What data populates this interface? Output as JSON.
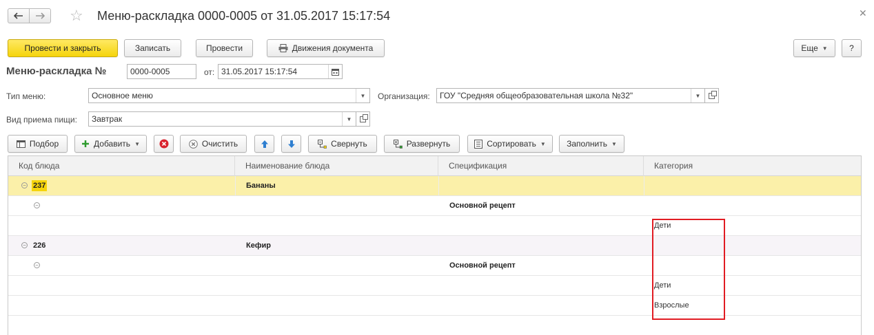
{
  "window": {
    "title": "Меню-раскладка 0000-0005 от 31.05.2017 15:17:54"
  },
  "toolbar": {
    "post_close": "Провести и закрыть",
    "save": "Записать",
    "post": "Провести",
    "movements": "Движения документа",
    "more": "Еще",
    "help": "?"
  },
  "header": {
    "doc_label": "Меню-раскладка №",
    "number": "0000-0005",
    "from_label": "от:",
    "date": "31.05.2017 15:17:54",
    "menu_type_label": "Тип меню:",
    "menu_type": "Основное меню",
    "org_label": "Организация:",
    "org": "ГОУ \"Средняя общеобразовательная школа №32\"",
    "meal_label": "Вид приема пищи:",
    "meal": "Завтрак"
  },
  "table_toolbar": {
    "pick": "Подбор",
    "add": "Добавить",
    "clear": "Очистить",
    "collapse": "Свернуть",
    "expand": "Развернуть",
    "sort": "Сортировать",
    "fill": "Заполнить"
  },
  "table": {
    "columns": [
      "Код блюда",
      "Наименование блюда",
      "Спецификация",
      "Категория"
    ],
    "rows": [
      {
        "code": "237",
        "name": "Бананы",
        "spec": "",
        "category": ""
      },
      {
        "code": "",
        "name": "",
        "spec": "Основной рецепт",
        "category": ""
      },
      {
        "code": "",
        "name": "",
        "spec": "",
        "category": "Дети"
      },
      {
        "code": "226",
        "name": "Кефир",
        "spec": "",
        "category": ""
      },
      {
        "code": "",
        "name": "",
        "spec": "Основной рецепт",
        "category": ""
      },
      {
        "code": "",
        "name": "",
        "spec": "",
        "category": "Дети"
      },
      {
        "code": "",
        "name": "",
        "spec": "",
        "category": "Взрослые"
      }
    ]
  },
  "colors": {
    "accent_yellow": "#f5d40c",
    "selected_row": "#fbf0a9",
    "highlight_box": "#e11b22"
  }
}
